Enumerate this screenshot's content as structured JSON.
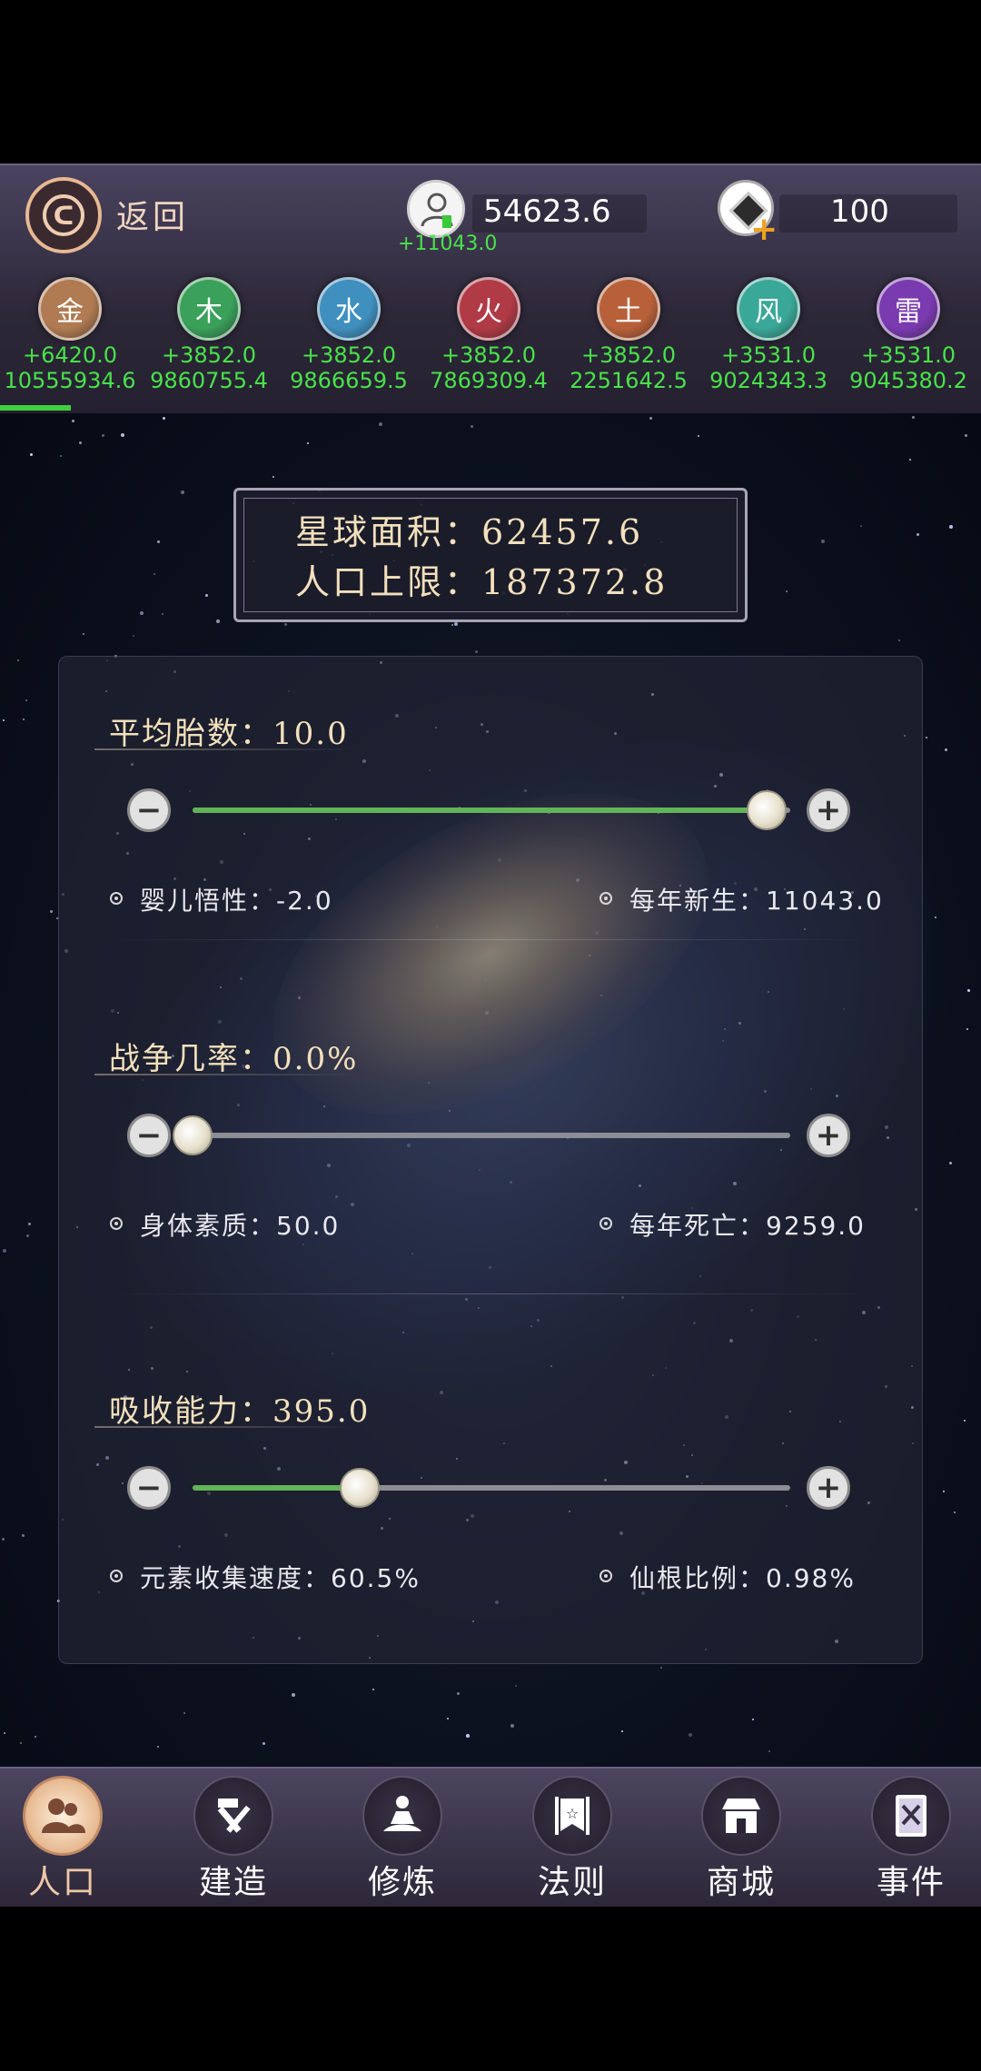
{
  "header": {
    "back_label": "返回",
    "population": "54623.6",
    "population_delta": "+11043.0",
    "gems": "100"
  },
  "elements": [
    {
      "name": "金",
      "rate": "+6420.0",
      "total": "10555934.6",
      "color": "#b07a52"
    },
    {
      "name": "木",
      "rate": "+3852.0",
      "total": "9860755.4",
      "color": "#3aa05a"
    },
    {
      "name": "水",
      "rate": "+3852.0",
      "total": "9866659.5",
      "color": "#3f8fbf"
    },
    {
      "name": "火",
      "rate": "+3852.0",
      "total": "7869309.4",
      "color": "#b03a46"
    },
    {
      "name": "土",
      "rate": "+3852.0",
      "total": "2251642.5",
      "color": "#b8603a"
    },
    {
      "name": "风",
      "rate": "+3531.0",
      "total": "9024343.3",
      "color": "#3aa898"
    },
    {
      "name": "雷",
      "rate": "+3531.0",
      "total": "9045380.2",
      "color": "#7a3ab0"
    }
  ],
  "planet": {
    "area": "星球面积：62457.6",
    "pop_limit": "人口上限：187372.8"
  },
  "settings": [
    {
      "title": "平均胎数：10.0",
      "level": 0.96,
      "stat_left": "婴儿悟性：-2.0",
      "stat_right": "每年新生：11043.0"
    },
    {
      "title": "战争几率：0.0%",
      "level": 0.0,
      "stat_left": "身体素质：50.0",
      "stat_right": "每年死亡：9259.0"
    },
    {
      "title": "吸收能力：395.0",
      "level": 0.28,
      "stat_left": "元素收集速度：60.5%",
      "stat_right": "仙根比例：0.98%"
    }
  ],
  "nav": [
    {
      "label": "人口",
      "icon": "people-icon",
      "active": true
    },
    {
      "label": "建造",
      "icon": "tools-icon"
    },
    {
      "label": "修炼",
      "icon": "meditation-icon"
    },
    {
      "label": "法则",
      "icon": "banner-icon"
    },
    {
      "label": "商城",
      "icon": "shop-icon"
    },
    {
      "label": "事件",
      "icon": "book-icon"
    }
  ],
  "colors": {
    "accent_green": "#49e24a",
    "slider_fill": "#62b458",
    "title_text": "#f2e0bc"
  }
}
